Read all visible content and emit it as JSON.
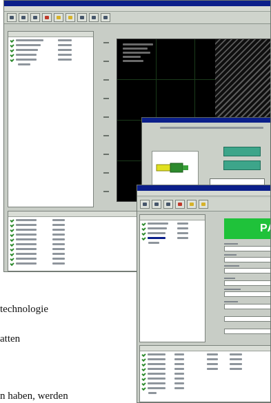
{
  "icons": {
    "check": "check-icon",
    "toolbar": [
      "new-icon",
      "open-icon",
      "save-icon",
      "stop-icon",
      "play-icon",
      "chart-icon",
      "zoom-icon",
      "settings-icon",
      "info-icon"
    ]
  },
  "colors": {
    "title_bar": "#0b1f8a",
    "pass_indicator": "#1fc23a",
    "scope_background": "#000000",
    "teal_fields": "#3da58a",
    "connector_yellow": "#e0e020",
    "connector_green": "#2d8a2d"
  },
  "pass_indicator": {
    "label": "PAS"
  },
  "body_text": {
    "line1": "technologie",
    "line2": "atten",
    "line3": "n haben, werden"
  }
}
